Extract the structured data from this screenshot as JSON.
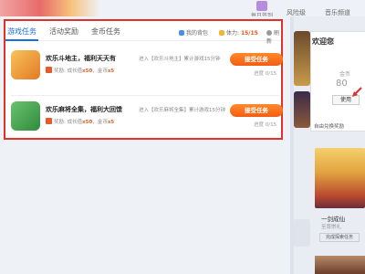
{
  "header": {
    "daily_checkin": "每日签到",
    "nav_1": "风险级",
    "nav_2": "音乐频道"
  },
  "panel": {
    "tabs": [
      "游戏任务",
      "活动奖励",
      "金币任务"
    ],
    "my_bag": "我的背包",
    "stamina_label": "体力:",
    "stamina_value": "15/15",
    "refresh": "刷新"
  },
  "tasks": [
    {
      "title": "欢乐斗地主，福利天天有",
      "desc": "进入【欢乐斗地主】累计游戏15分钟",
      "reward_prefix": "奖励:",
      "reward_text_1": "成长值",
      "reward_growth": "x50",
      "reward_text_2": "金币",
      "reward_coin": "x5",
      "button": "接受任务",
      "progress": "进度 0/15"
    },
    {
      "title": "欢乐麻将全集，福利大回馈",
      "desc": "进入【欢乐麻将全集】累计游戏15分钟",
      "reward_prefix": "奖励:",
      "reward_text_1": "成长值",
      "reward_growth": "x50",
      "reward_text_2": "金币",
      "reward_coin": "x5",
      "button": "接受任务",
      "progress": "进度 0/15"
    }
  ],
  "sidebar": {
    "welcome": "欢迎您",
    "coin_label": "金币",
    "coin_value": "80",
    "use_button": "使用",
    "redeem": "自由兑换奖励"
  },
  "game_card": {
    "name": "一剑成仙",
    "sub": "至尊崇礼",
    "button": "完成探索任务"
  },
  "colors": {
    "accent_blue": "#1a6fd8",
    "accent_orange": "#f25d12",
    "highlight_red": "#e0312b"
  }
}
